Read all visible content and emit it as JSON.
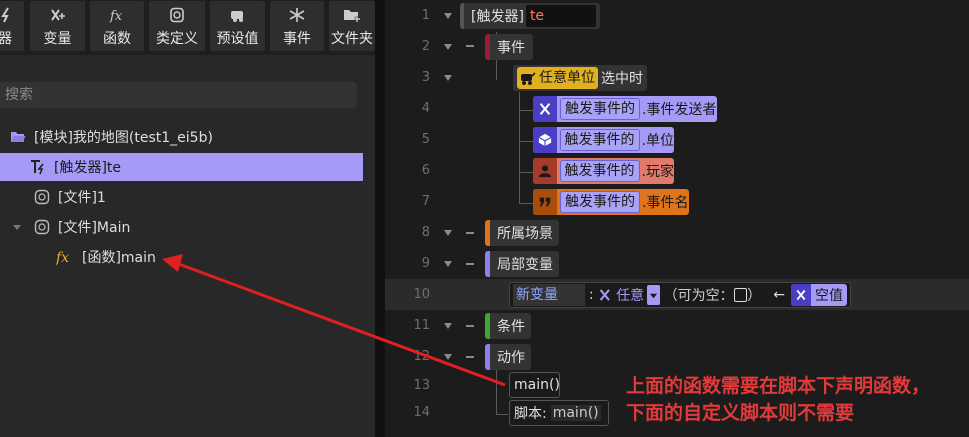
{
  "toolbar": {
    "items": [
      {
        "label": "器",
        "icon": "trigger-icon"
      },
      {
        "label": "变量",
        "icon": "variable-icon"
      },
      {
        "label": "函数",
        "icon": "function-icon"
      },
      {
        "label": "类定义",
        "icon": "class-icon"
      },
      {
        "label": "预设值",
        "icon": "preset-icon"
      },
      {
        "label": "事件",
        "icon": "event-icon"
      },
      {
        "label": "文件夹",
        "icon": "folder-add-icon"
      }
    ]
  },
  "search": {
    "placeholder": "搜索"
  },
  "tree": {
    "module": "[模块]我的地图(test1_ei5b)",
    "trigger": "[触发器]te",
    "file1": "[文件]1",
    "fileMain": "[文件]Main",
    "func": "[函数]main"
  },
  "code": {
    "line_numbers": [
      "1",
      "2",
      "3",
      "4",
      "5",
      "6",
      "7",
      "8",
      "9",
      "10",
      "11",
      "12",
      "13",
      "14"
    ],
    "trigger_label": "[触发器]",
    "trigger_name": "te",
    "event_header": "事件",
    "any_unit": "任意单位",
    "selected": "选中时",
    "trigger_event": "触发事件的",
    "sender": ".事件发送者",
    "unit": ".单位",
    "player": ".玩家",
    "event_name": ".事件名",
    "scene": "所属场景",
    "local_vars": "局部变量",
    "new_var": "新变量",
    "colon": ":",
    "any_type": "任意",
    "nullable": "（可为空：",
    "nullable_close": "）",
    "arrow": "←",
    "null_val": "空值",
    "condition": "条件",
    "action": "动作",
    "call_main": "main()",
    "script_label": "脚本:",
    "script_value": "main()"
  },
  "annotation": {
    "line1": "上面的函数需要在脚本下声明函数，",
    "line2": "下面的自定义脚本则不需要"
  },
  "colors": {
    "accent": "#a59af5",
    "event": "#9b1b3a",
    "scene": "#e0741a",
    "local": "#8b80f0",
    "condition": "#3fa535",
    "annotation": "#e23a3a"
  }
}
